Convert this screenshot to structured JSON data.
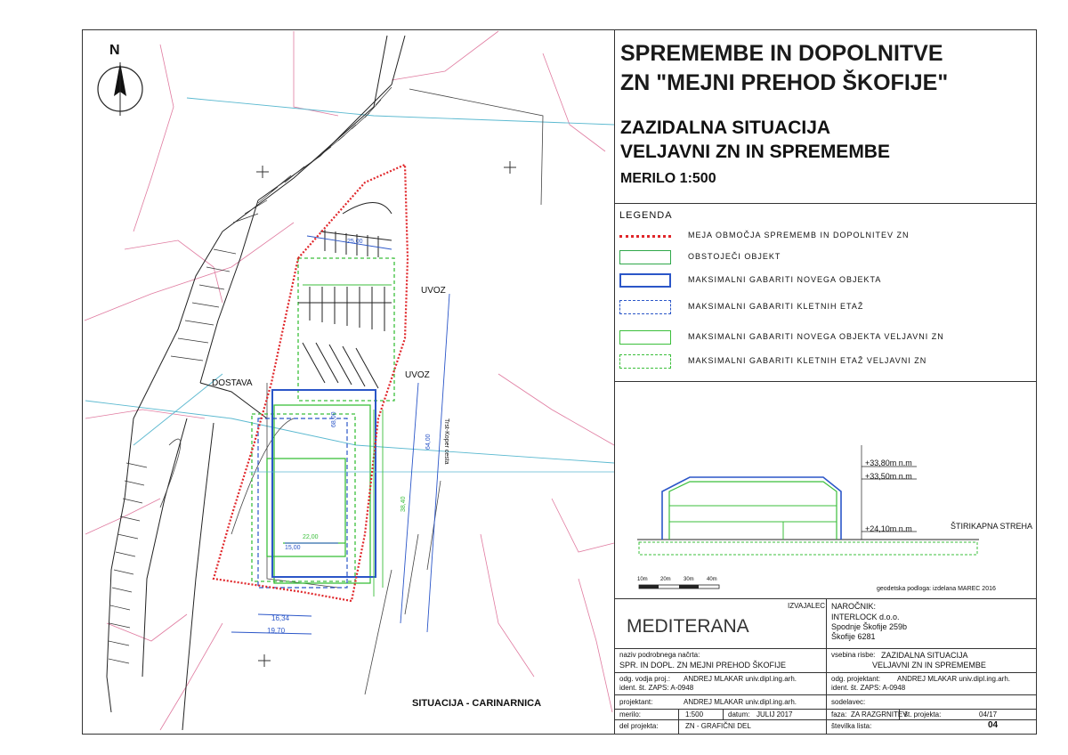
{
  "title": {
    "line1": "SPREMEMBE IN DOPOLNITVE",
    "line2": "ZN \"MEJNI PREHOD ŠKOFIJE\""
  },
  "subtitle": {
    "line1": "ZAZIDALNA SITUACIJA",
    "line2": "VELJAVNI ZN IN SPREMEMBE"
  },
  "scale": "MERILO 1:500",
  "legend": {
    "title": "LEGENDA",
    "items": [
      {
        "label": "MEJA OBMOČJA SPREMEMB IN DOPOLNITEV ZN",
        "color": "#e0262a",
        "style": "dotted"
      },
      {
        "label": "OBSTOJEČI OBJEKT",
        "color": "#2fa84a",
        "style": "solid"
      },
      {
        "label": "MAKSIMALNI GABARITI NOVEGA OBJEKTA",
        "color": "#2b56c8",
        "style": "solid"
      },
      {
        "label": "MAKSIMALNI GABARITI KLETNIH ETAŽ",
        "color": "#2b56c8",
        "style": "dashed"
      },
      {
        "label": "MAKSIMALNI GABARITI NOVEGA OBJEKTA VELJAVNI ZN",
        "color": "#3bbf3b",
        "style": "solid"
      },
      {
        "label": "MAKSIMALNI GABARITI KLETNIH ETAŽ VELJAVNI ZN",
        "color": "#3bbf3b",
        "style": "dashed"
      }
    ]
  },
  "section": {
    "level1": "+33,80m n.m",
    "level2": "+33,50m n.m",
    "level3": "+24,10m n.m",
    "roof": "ŠTIRIKAPNA STREHA"
  },
  "scalebar": {
    "labels": [
      "10m",
      "20m",
      "30m",
      "40m"
    ],
    "note": "geodetska podloga: izdelana MAREC 2016"
  },
  "plan": {
    "north": "N",
    "title": "SITUACIJA - CARINARNICA",
    "labels": {
      "uvoz1": "UVOZ",
      "uvoz2": "UVOZ",
      "dostava": "DOSTAVA",
      "road": "Trst-Koper cesta",
      "dim1": "25,00",
      "dim2": "68,00",
      "dim3": "22,00",
      "dim4": "15,00",
      "dim5": "16,34",
      "dim6": "19,70",
      "dim7": "38,40",
      "dim8": "64,00"
    }
  },
  "titleblock": {
    "izvajalec": "IZVAJALEC",
    "narocnik_label": "NAROČNIK:",
    "narocnik_lines": [
      "INTERLOCK d.o.o.",
      "Spodnje Škofije 259b",
      "Škofije 6281"
    ],
    "logo": "MEDITERANA",
    "naziv_label": "naziv podrobnega načrta:",
    "naziv_value": "SPR. IN DOPL. ZN MEJNI PREHOD ŠKOFIJE",
    "vsebina_label": "vsebina risbe:",
    "vsebina_value1": "ZAZIDALNA SITUACIJA",
    "vsebina_value2": "VELJAVNI ZN IN SPREMEMBE",
    "vodja_label": "odg. vodja proj.:",
    "vodja_value": "ANDREJ MLAKAR univ.dipl.ing.arh.",
    "vodja_id": "ident. št. ZAPS: A-0948",
    "odg_label": "odg. projektant:",
    "odg_value": "ANDREJ MLAKAR univ.dipl.ing.arh.",
    "odg_id": "ident. št. ZAPS: A-0948",
    "projektant_label": "projektant:",
    "projektant_value": "ANDREJ MLAKAR univ.dipl.ing.arh.",
    "sodelavec_label": "sodelavec:",
    "merilo_label": "merilo:",
    "merilo_value": "1:500",
    "datum_label": "datum:",
    "datum_value": "JULIJ 2017",
    "faza_label": "faza:",
    "faza_value": "ZA RAZGRNITEV",
    "stproj_label": "št. projekta:",
    "stproj_value": "04/17",
    "del_label": "del projekta:",
    "del_value": "ZN - GRAFIČNI DEL",
    "stlist_label": "številka lista:",
    "stlist_value": "04"
  },
  "colors": {
    "boundary": "#e0262a",
    "existing": "#2fa84a",
    "new": "#2b56c8",
    "valid": "#3bbf3b",
    "cadastre": "#e07ba0",
    "parcel": "#3aa6c8"
  }
}
